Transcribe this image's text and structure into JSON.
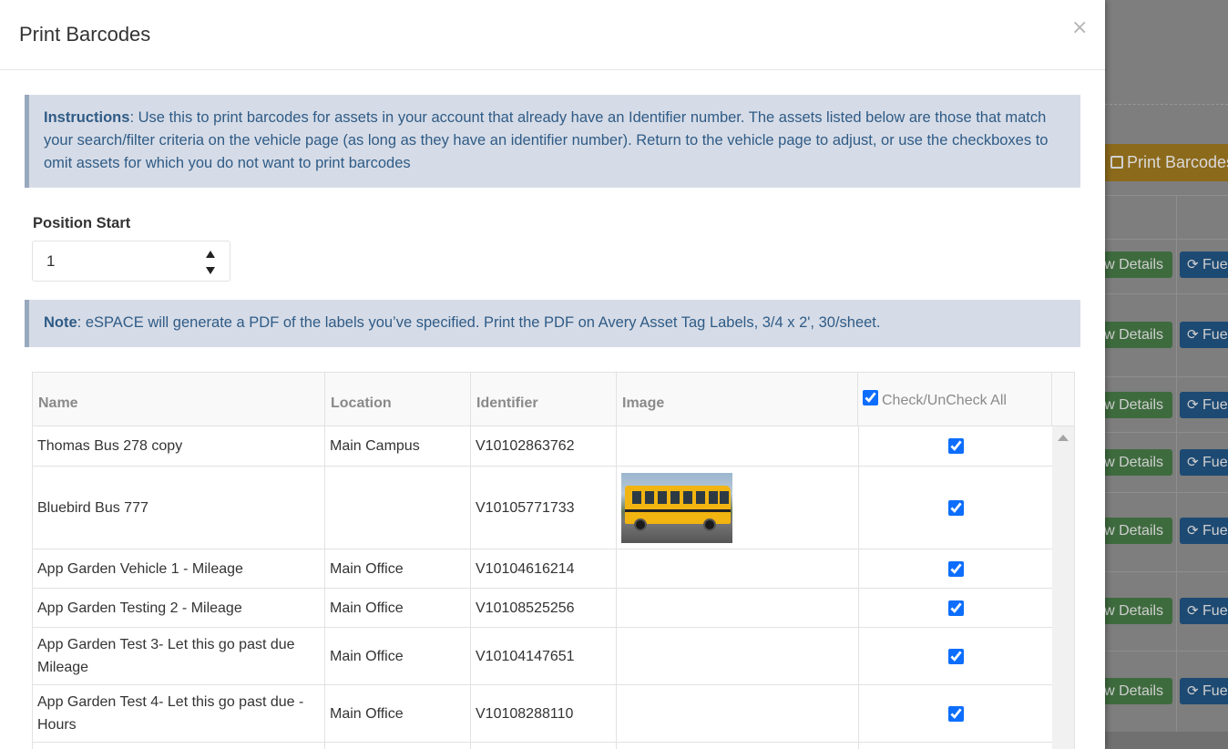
{
  "modal": {
    "title": "Print Barcodes",
    "close_label": "×"
  },
  "instructions": {
    "label": "Instructions",
    "text": ": Use this to print barcodes for assets in your account that already have an Identifier number. The assets listed below are those that match your search/filter criteria on the vehicle page (as long as they have an identifier number). Return to the vehicle page to adjust, or use the checkboxes to omit assets for which you do not want to print barcodes"
  },
  "position_start": {
    "label": "Position Start",
    "value": "1"
  },
  "note": {
    "label": "Note",
    "text": ": eSPACE will generate a PDF of the labels you’ve specified. Print the PDF on Avery Asset Tag Labels, 3/4 x 2', 30/sheet."
  },
  "table": {
    "headers": {
      "name": "Name",
      "location": "Location",
      "identifier": "Identifier",
      "image": "Image",
      "check_all": "Check/UnCheck All"
    },
    "rows": [
      {
        "name": "Thomas Bus 278 copy",
        "location": "Main Campus",
        "identifier": "V10102863762",
        "has_image": false,
        "checked": true
      },
      {
        "name": "Bluebird Bus 777",
        "location": "",
        "identifier": "V10105771733",
        "has_image": true,
        "checked": true
      },
      {
        "name": "App Garden Vehicle 1 - Mileage",
        "location": "Main Office",
        "identifier": "V10104616214",
        "has_image": false,
        "checked": true
      },
      {
        "name": "App Garden Testing 2 - Mileage",
        "location": "Main Office",
        "identifier": "V10108525256",
        "has_image": false,
        "checked": true
      },
      {
        "name": "App Garden Test 3- Let this go past due Mileage",
        "location": "Main Office",
        "identifier": "V10104147651",
        "has_image": false,
        "checked": true
      },
      {
        "name": "App Garden Test 4- Let this go past due - Hours",
        "location": "Main Office",
        "identifier": "V10108288110",
        "has_image": false,
        "checked": true
      }
    ]
  },
  "background": {
    "print_button_label": "Print Barcodes",
    "details_label": "w Details",
    "fuel_label": "Fue"
  },
  "colors": {
    "alert_bg": "#d6dce7",
    "alert_text": "#2f5b86",
    "checkbox_accent": "#0d6efd"
  }
}
